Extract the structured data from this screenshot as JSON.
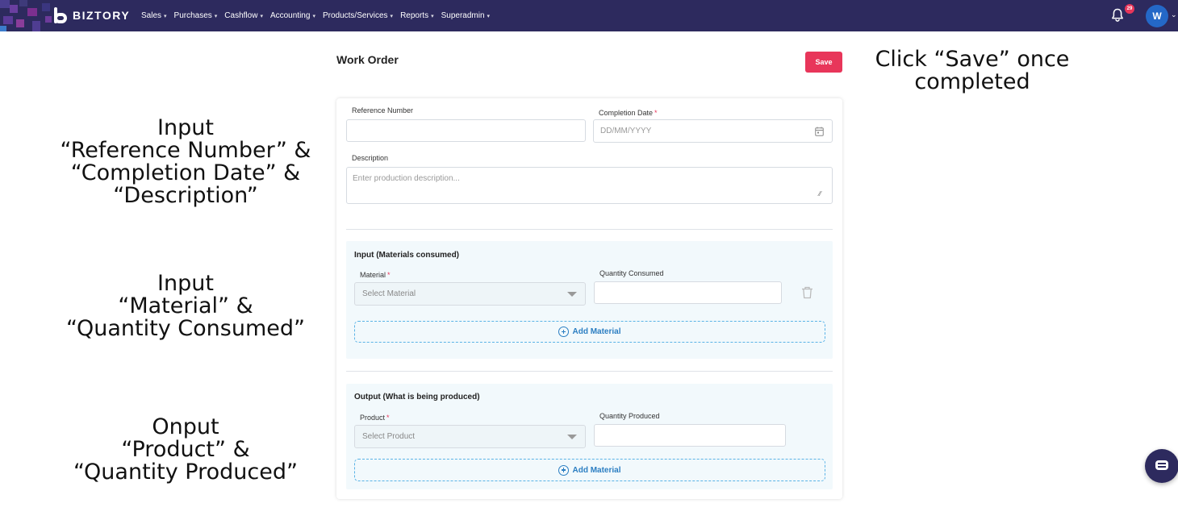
{
  "brand": {
    "name": "BIZTORY"
  },
  "nav": {
    "items": [
      {
        "label": "Sales"
      },
      {
        "label": "Purchases"
      },
      {
        "label": "Cashflow"
      },
      {
        "label": "Accounting"
      },
      {
        "label": "Products/Services"
      },
      {
        "label": "Reports"
      },
      {
        "label": "Superadmin"
      }
    ],
    "notification_count": "29",
    "avatar_initial": "W"
  },
  "page": {
    "title": "Work Order",
    "save_label": "Save"
  },
  "form": {
    "reference_number_label": "Reference Number",
    "reference_number_value": "",
    "completion_date_label": "Completion Date",
    "completion_date_placeholder": "DD/MM/YYYY",
    "description_label": "Description",
    "description_placeholder": "Enter production description...",
    "required_mark": "*"
  },
  "input_section": {
    "title": "Input (Materials consumed)",
    "material_label": "Material",
    "material_placeholder": "Select Material",
    "quantity_label": "Quantity Consumed",
    "add_label": "Add Material"
  },
  "output_section": {
    "title": "Output (What is being produced)",
    "product_label": "Product",
    "product_placeholder": "Select Product",
    "quantity_label": "Quantity Produced",
    "add_label": "Add Material"
  },
  "annotations": {
    "save": [
      "Click “Save” once",
      "completed"
    ],
    "reference": [
      "Input",
      "“Reference Number” &",
      "“Completion Date” &",
      "“Description”"
    ],
    "material": [
      "Input",
      "“Material” &",
      "“Quantity Consumed”"
    ],
    "product": [
      "Onput",
      "“Product” &",
      "“Quantity Produced”"
    ]
  },
  "colors": {
    "nav_bg": "#2d2a5e",
    "accent": "#e8365a",
    "link_blue": "#2b7ec2",
    "section_bg": "#f2f9fc"
  }
}
